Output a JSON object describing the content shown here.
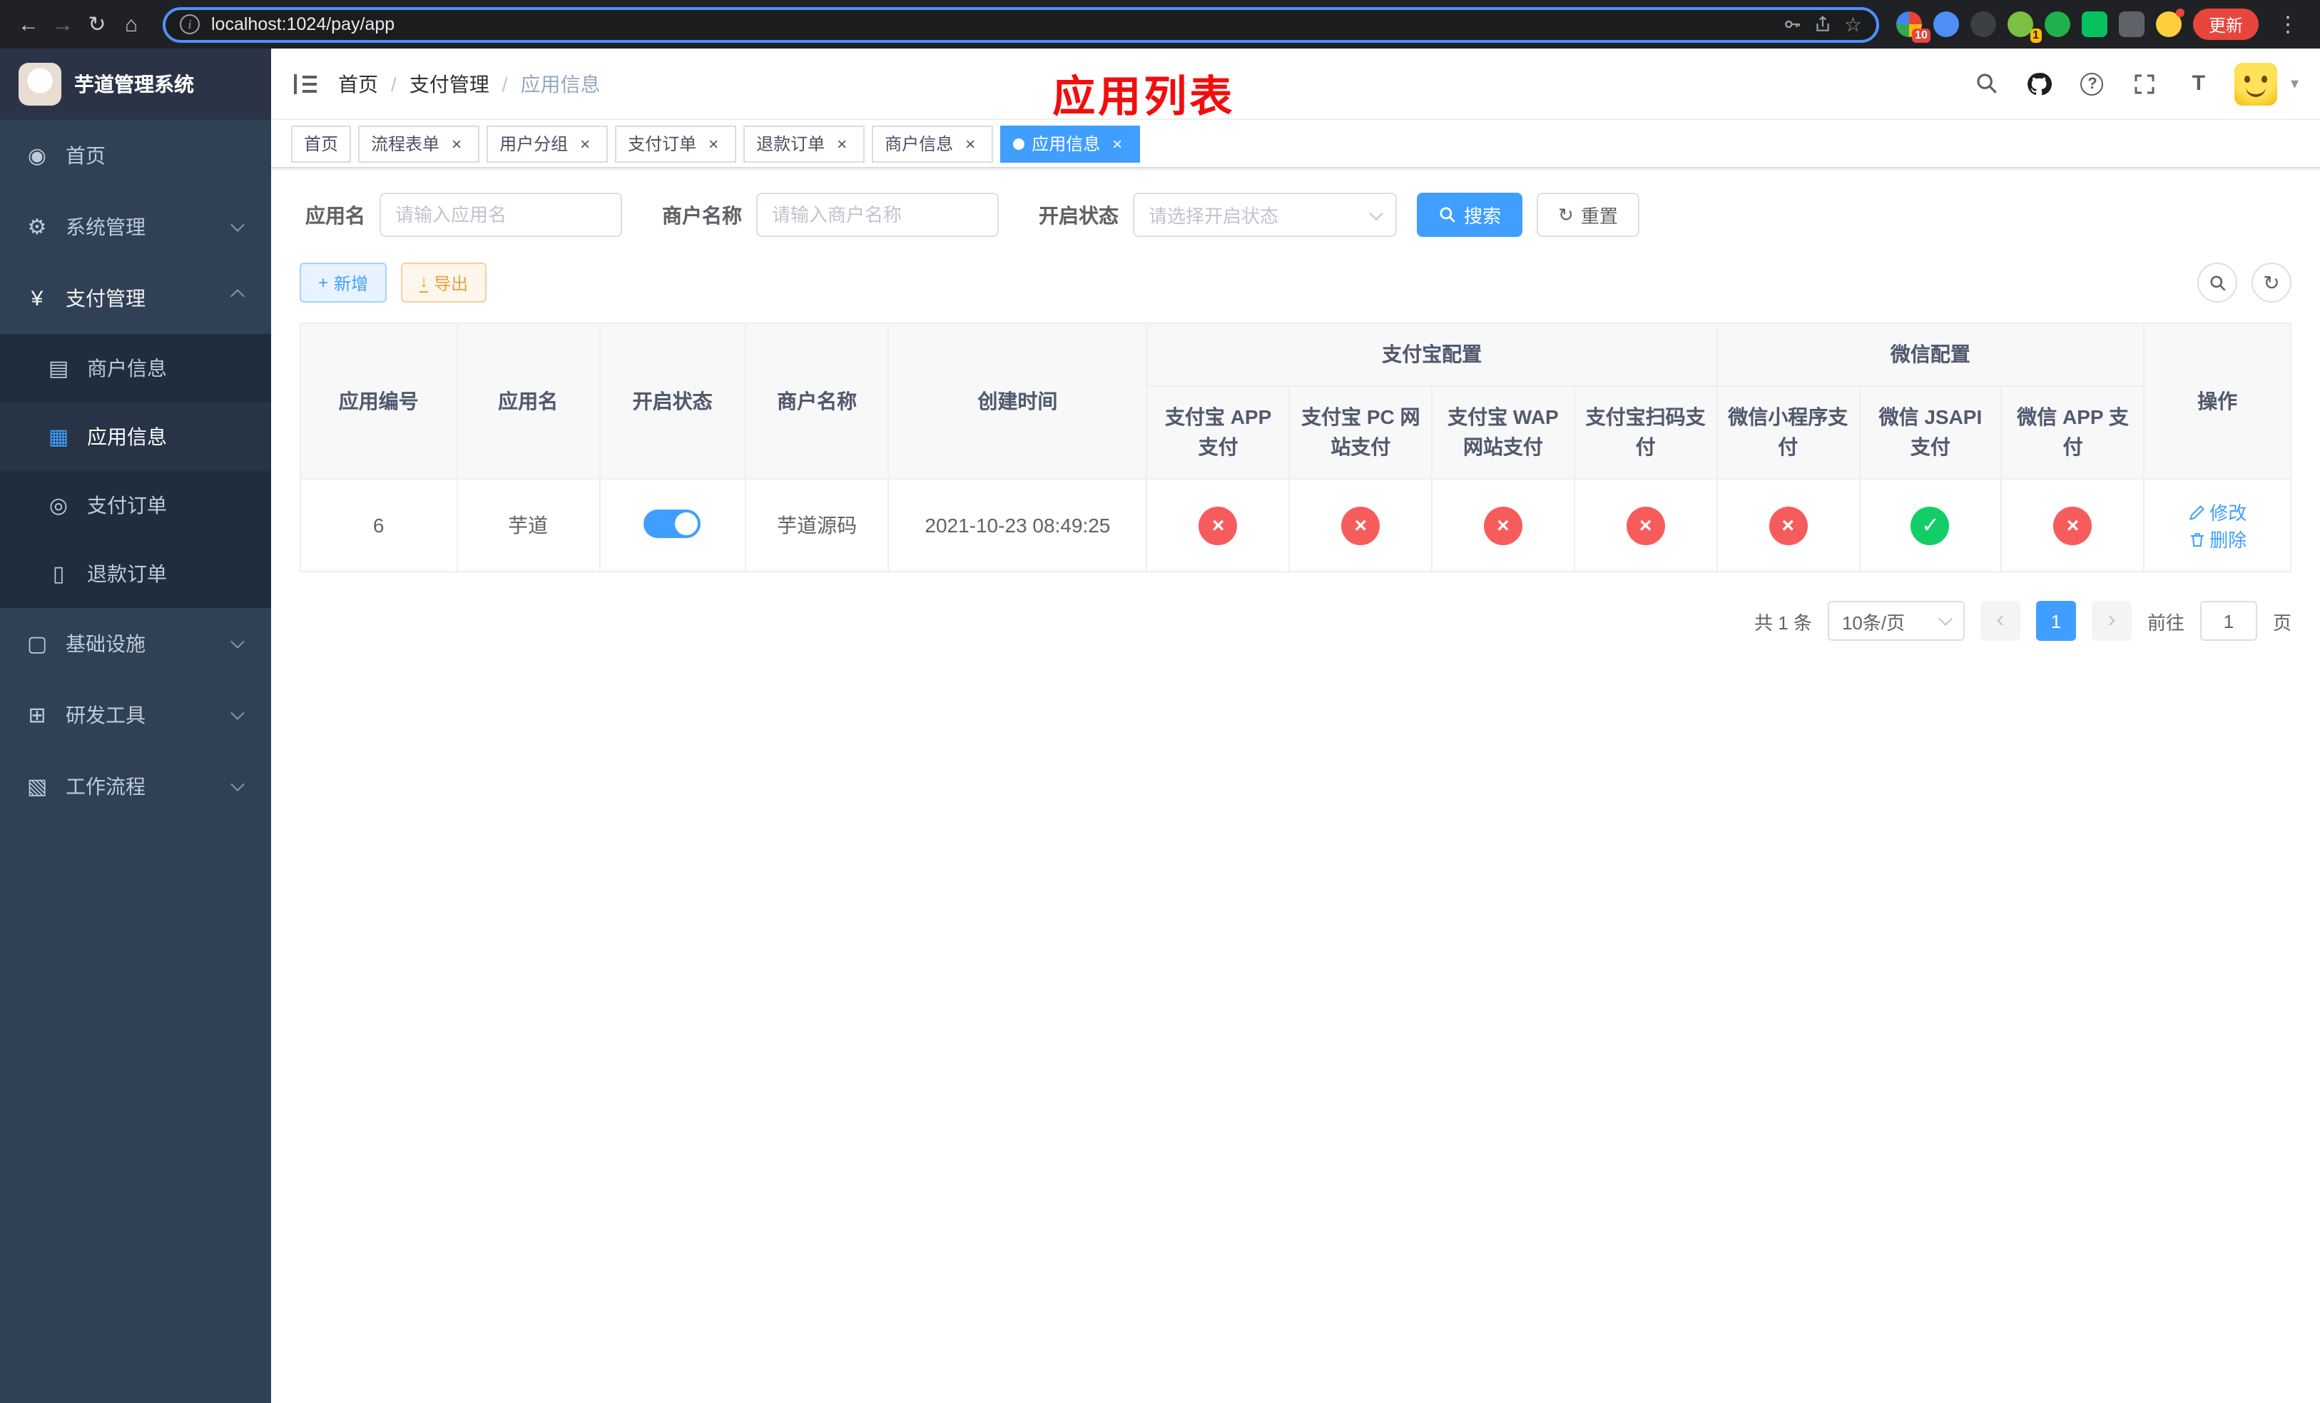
{
  "colors": {
    "accent": "#409eff",
    "danger": "#f75c5c",
    "success": "#13ce66",
    "warning": "#e6a23c",
    "sidebar_bg": "#304156",
    "submenu_bg": "#1f2d3d",
    "update_red": "#e8453c",
    "overlay_red": "#f20d0d"
  },
  "icons": {
    "back": "←",
    "forward": "→",
    "reload": "↻",
    "home": "⌂",
    "info": "i",
    "star": "☆",
    "kebab": "⋮",
    "dashboard": "◉",
    "gear": "⚙",
    "yen": "¥",
    "merchant_card": "▤",
    "app_grid": "▦",
    "order_circle": "◎",
    "refund_doc": "▯",
    "infra": "▢",
    "devtool": "⊞",
    "workflow": "▧",
    "close": "×",
    "plus": "+",
    "refresh": "↻",
    "caret": "▾",
    "font_size": "T",
    "download": "↓"
  },
  "browser": {
    "url": "localhost:1024/pay/app",
    "update_button": "更新",
    "ext_badge_1": "10",
    "ext_badge_2": "1"
  },
  "sidebar": {
    "app_title": "芋道管理系统",
    "items": {
      "home": "首页",
      "system": "系统管理",
      "pay": "支付管理",
      "infra": "基础设施",
      "dev": "研发工具",
      "workflow": "工作流程"
    },
    "pay_children": {
      "merchant": "商户信息",
      "app": "应用信息",
      "order": "支付订单",
      "refund": "退款订单"
    }
  },
  "breadcrumb": {
    "home": "首页",
    "section": "支付管理",
    "page": "应用信息",
    "separator": "/"
  },
  "overlay_title": "应用列表",
  "tabs": [
    {
      "label": "首页"
    },
    {
      "label": "流程表单"
    },
    {
      "label": "用户分组"
    },
    {
      "label": "支付订单"
    },
    {
      "label": "退款订单"
    },
    {
      "label": "商户信息"
    },
    {
      "label": "应用信息"
    }
  ],
  "filters": {
    "app_name_label": "应用名",
    "app_name_placeholder": "请输入应用名",
    "merchant_label": "商户名称",
    "merchant_placeholder": "请输入商户名称",
    "status_label": "开启状态",
    "status_placeholder": "请选择开启状态",
    "search_button": "搜索",
    "reset_button": "重置"
  },
  "toolbar": {
    "add_button": "新增",
    "export_button": "导出"
  },
  "table": {
    "headers": {
      "app_id": "应用编号",
      "app_name": "应用名",
      "status": "开启状态",
      "merchant": "商户名称",
      "created": "创建时间",
      "alipay_group": "支付宝配置",
      "wechat_group": "微信配置",
      "alipay_app": "支付宝 APP 支付",
      "alipay_pc": "支付宝 PC 网站支付",
      "alipay_wap": "支付宝 WAP 网站支付",
      "alipay_qr": "支付宝扫码支付",
      "wx_lite": "微信小程序支付",
      "wx_jsapi": "微信 JSAPI 支付",
      "wx_app": "微信 APP 支付",
      "action": "操作"
    },
    "rows": [
      {
        "app_id": "6",
        "app_name": "芋道",
        "enabled": true,
        "merchant": "芋道源码",
        "created": "2021-10-23 08:49:25",
        "channels": {
          "alipay_app": false,
          "alipay_pc": false,
          "alipay_wap": false,
          "alipay_qr": false,
          "wx_lite": false,
          "wx_jsapi": true,
          "wx_app": false
        },
        "actions": {
          "edit": "修改",
          "delete": "删除"
        }
      }
    ]
  },
  "pagination": {
    "total": "共 1 条",
    "page_size": "10条/页",
    "page": "1",
    "goto_label": "前往",
    "goto_value": "1",
    "goto_suffix": "页"
  }
}
